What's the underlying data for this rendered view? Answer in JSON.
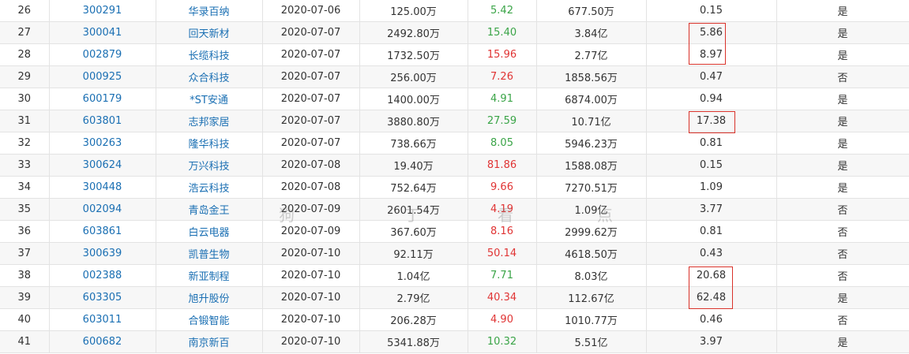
{
  "rows": [
    {
      "idx": "26",
      "code": "300291",
      "name": "华录百纳",
      "date": "2020-07-06",
      "amount": "125.00万",
      "ratio": "5.42",
      "ratio_dir": "down",
      "market": "677.50万",
      "value": "0.15",
      "flag": "是"
    },
    {
      "idx": "27",
      "code": "300041",
      "name": "回天新材",
      "date": "2020-07-07",
      "amount": "2492.80万",
      "ratio": "15.40",
      "ratio_dir": "down",
      "market": "3.84亿",
      "value": "5.86",
      "flag": "是"
    },
    {
      "idx": "28",
      "code": "002879",
      "name": "长缆科技",
      "date": "2020-07-07",
      "amount": "1732.50万",
      "ratio": "15.96",
      "ratio_dir": "up",
      "market": "2.77亿",
      "value": "8.97",
      "flag": "是"
    },
    {
      "idx": "29",
      "code": "000925",
      "name": "众合科技",
      "date": "2020-07-07",
      "amount": "256.00万",
      "ratio": "7.26",
      "ratio_dir": "up",
      "market": "1858.56万",
      "value": "0.47",
      "flag": "否"
    },
    {
      "idx": "30",
      "code": "600179",
      "name": "*ST安通",
      "date": "2020-07-07",
      "amount": "1400.00万",
      "ratio": "4.91",
      "ratio_dir": "down",
      "market": "6874.00万",
      "value": "0.94",
      "flag": "是"
    },
    {
      "idx": "31",
      "code": "603801",
      "name": "志邦家居",
      "date": "2020-07-07",
      "amount": "3880.80万",
      "ratio": "27.59",
      "ratio_dir": "down",
      "market": "10.71亿",
      "value": "17.38",
      "flag": "是"
    },
    {
      "idx": "32",
      "code": "300263",
      "name": "隆华科技",
      "date": "2020-07-07",
      "amount": "738.66万",
      "ratio": "8.05",
      "ratio_dir": "down",
      "market": "5946.23万",
      "value": "0.81",
      "flag": "是"
    },
    {
      "idx": "33",
      "code": "300624",
      "name": "万兴科技",
      "date": "2020-07-08",
      "amount": "19.40万",
      "ratio": "81.86",
      "ratio_dir": "up",
      "market": "1588.08万",
      "value": "0.15",
      "flag": "是"
    },
    {
      "idx": "34",
      "code": "300448",
      "name": "浩云科技",
      "date": "2020-07-08",
      "amount": "752.64万",
      "ratio": "9.66",
      "ratio_dir": "up",
      "market": "7270.51万",
      "value": "1.09",
      "flag": "是"
    },
    {
      "idx": "35",
      "code": "002094",
      "name": "青岛金王",
      "date": "2020-07-09",
      "amount": "2601.54万",
      "ratio": "4.19",
      "ratio_dir": "up",
      "market": "1.09亿",
      "value": "3.77",
      "flag": "否"
    },
    {
      "idx": "36",
      "code": "603861",
      "name": "白云电器",
      "date": "2020-07-09",
      "amount": "367.60万",
      "ratio": "8.16",
      "ratio_dir": "up",
      "market": "2999.62万",
      "value": "0.81",
      "flag": "否"
    },
    {
      "idx": "37",
      "code": "300639",
      "name": "凯普生物",
      "date": "2020-07-10",
      "amount": "92.11万",
      "ratio": "50.14",
      "ratio_dir": "up",
      "market": "4618.50万",
      "value": "0.43",
      "flag": "否"
    },
    {
      "idx": "38",
      "code": "002388",
      "name": "新亚制程",
      "date": "2020-07-10",
      "amount": "1.04亿",
      "ratio": "7.71",
      "ratio_dir": "down",
      "market": "8.03亿",
      "value": "20.68",
      "flag": "否"
    },
    {
      "idx": "39",
      "code": "603305",
      "name": "旭升股份",
      "date": "2020-07-10",
      "amount": "2.79亿",
      "ratio": "40.34",
      "ratio_dir": "up",
      "market": "112.67亿",
      "value": "62.48",
      "flag": "是"
    },
    {
      "idx": "40",
      "code": "603011",
      "name": "合锻智能",
      "date": "2020-07-10",
      "amount": "206.28万",
      "ratio": "4.90",
      "ratio_dir": "up",
      "market": "1010.77万",
      "value": "0.46",
      "flag": "否"
    },
    {
      "idx": "41",
      "code": "600682",
      "name": "南京新百",
      "date": "2020-07-10",
      "amount": "5341.88万",
      "ratio": "10.32",
      "ratio_dir": "down",
      "market": "5.51亿",
      "value": "3.97",
      "flag": "是"
    }
  ],
  "colors": {
    "link": "#1a6fb3",
    "up": "#e03434",
    "down": "#3aa447",
    "highlight_border": "#d9322a"
  },
  "watermark": {
    "chars": [
      "狗",
      "丁",
      "看",
      "点"
    ]
  }
}
